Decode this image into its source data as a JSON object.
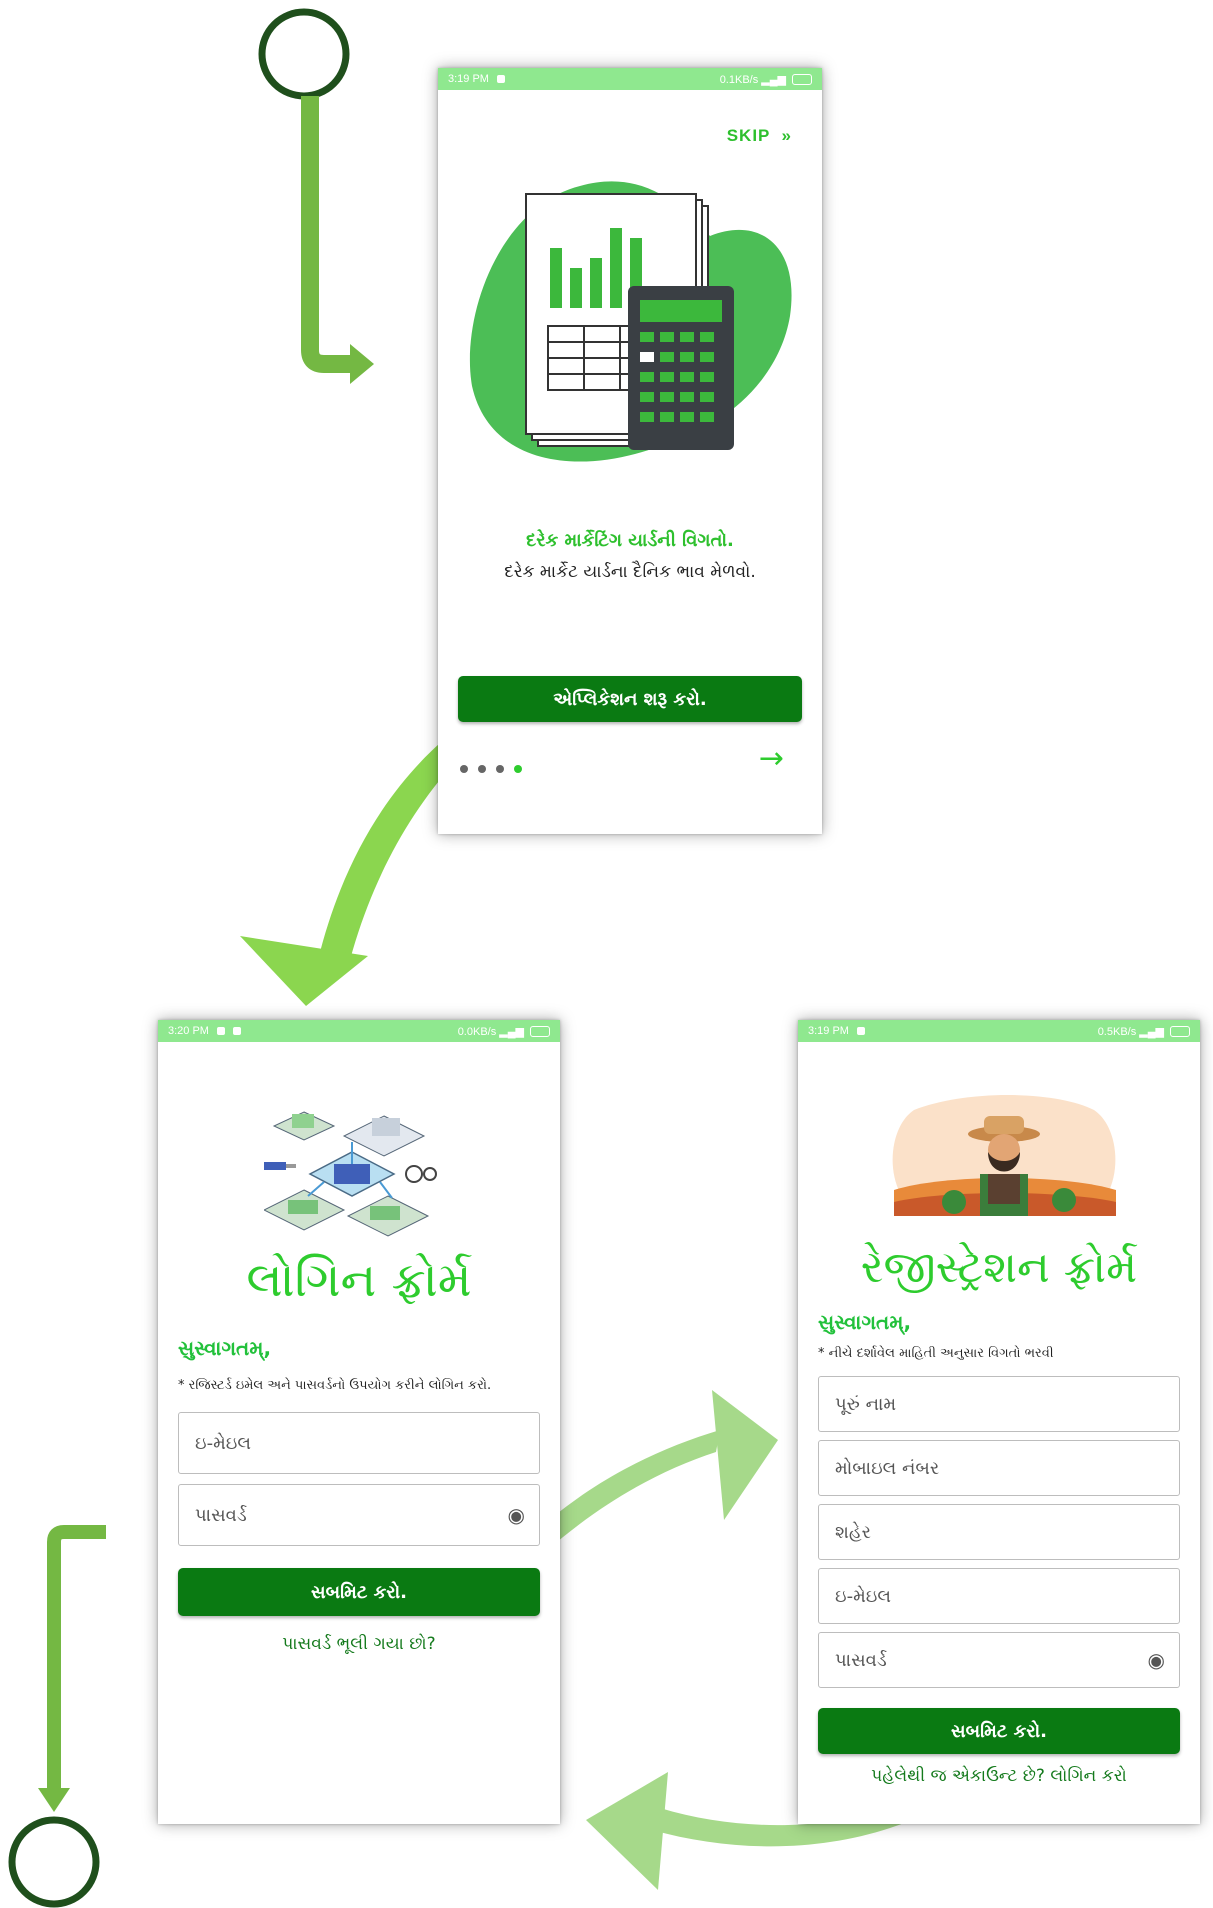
{
  "onboarding": {
    "status": {
      "time": "3:19 PM",
      "speed": "0.1KB/s"
    },
    "skip_label": "SKIP",
    "skip_icon": "double-chevron-right-icon",
    "headline": "દરેક માર્કેટિંગ યાર્ડની વિગતો.",
    "subline": "દરેક માર્કેટ યાર્ડના દૈનિક ભાવ મેળવો.",
    "start_button": "એપ્લિકેશન શરૂ કરો.",
    "page_count": 4,
    "active_page": 4
  },
  "login": {
    "status": {
      "time": "3:20 PM",
      "speed": "0.0KB/s"
    },
    "title": "લોગિન ફ્રોર્મ",
    "welcome": "સુસ્વાગતમ્,",
    "note": "* રજિસ્ટર્ડ ઇમેલ અને પાસવર્ડનો ઉપયોગ કરીને લોગિન કરો.",
    "email_placeholder": "ઇ-મેઇલ",
    "password_placeholder": "પાસવર્ડ",
    "submit": "સબમિટ કરો.",
    "forgot": "પાસવર્ડ ભૂલી ગયા છો?"
  },
  "register": {
    "status": {
      "time": "3:19 PM",
      "speed": "0.5KB/s"
    },
    "title": "રેજીસ્ટ્રેશન ફ્રોર્મ",
    "welcome": "સુસ્વાગતમ્,",
    "note": "* નીચે દર્શાવેલ માહિતી અનુસાર વિગતો ભરવી",
    "fields": [
      "પૂરું નામ",
      "મોબાઇલ નંબર",
      "શહેર",
      "ઇ-મેઇલ",
      "પાસવર્ડ"
    ],
    "submit": "સબમિટ કરો.",
    "login_link": "પહેલેથી જ એકાઉન્ટ છે? લોગિન કરો"
  },
  "colors": {
    "brand_green": "#0a7a12",
    "accent_green": "#2ecc2e",
    "status_green": "#8fe88f",
    "arrow_green": "#74b843"
  }
}
